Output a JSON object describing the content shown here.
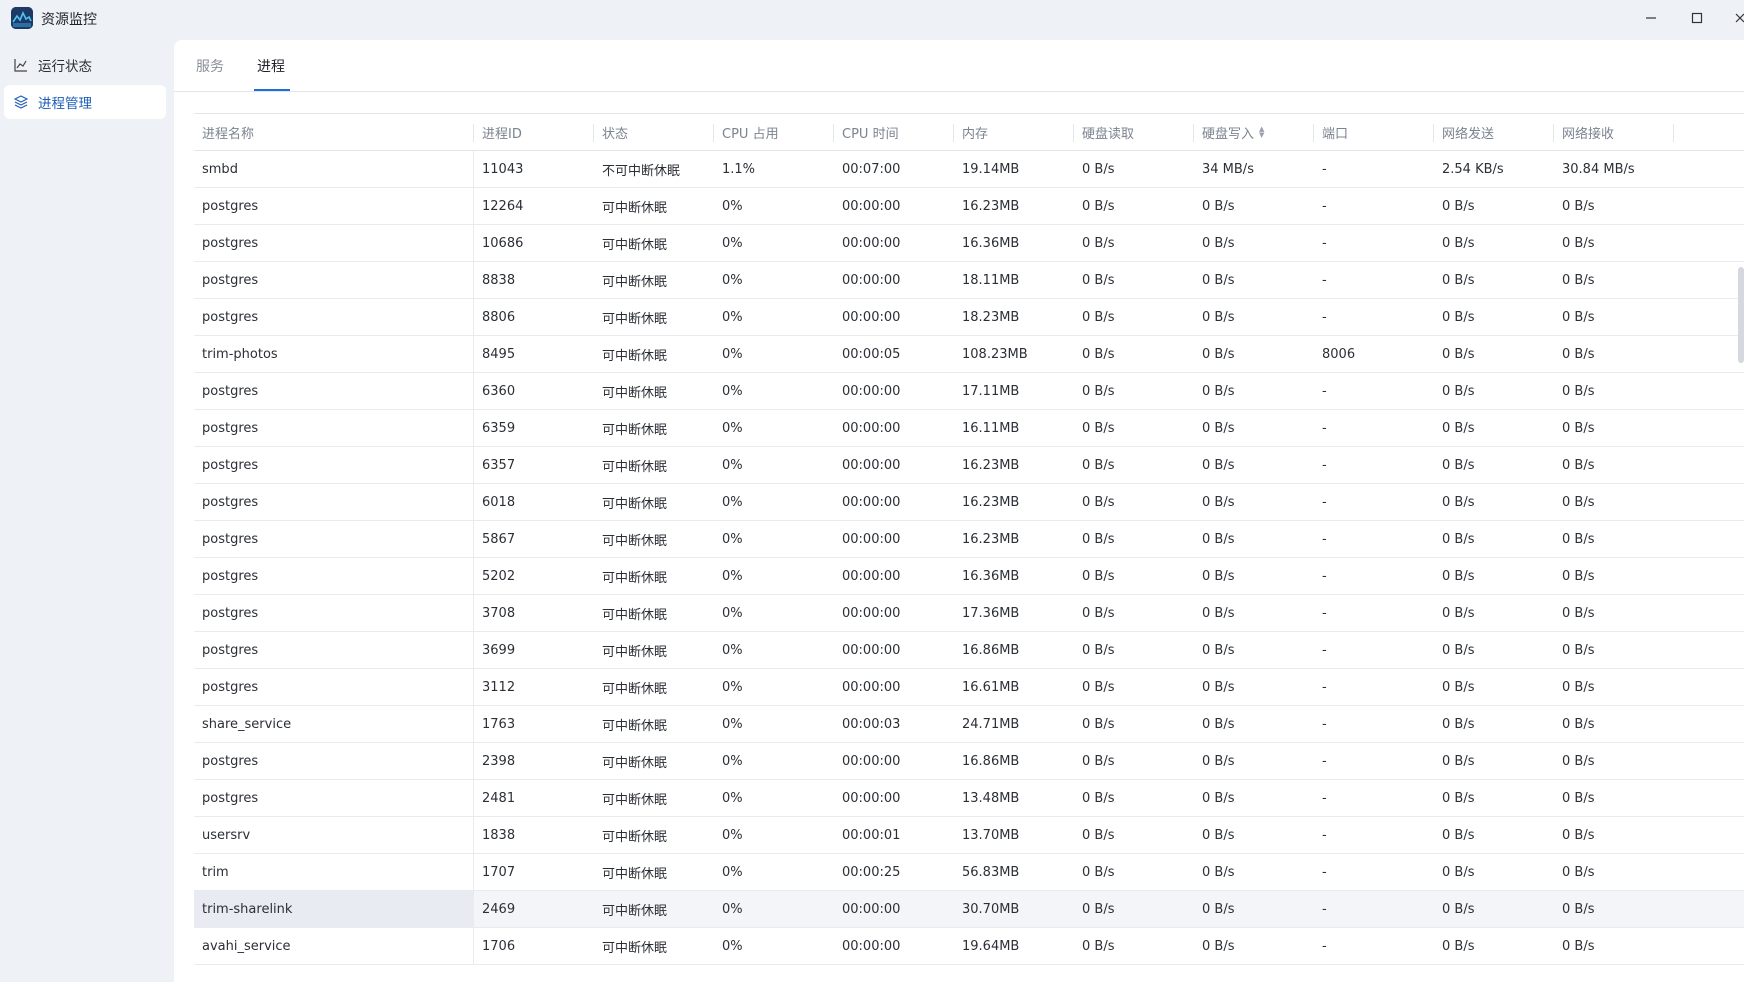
{
  "window": {
    "title": "资源监控",
    "controls": [
      "minimize-icon",
      "maximize-icon",
      "close-icon"
    ]
  },
  "sidebar": {
    "items": [
      {
        "label": "运行状态",
        "icon": "chart-line-icon",
        "active": false
      },
      {
        "label": "进程管理",
        "icon": "layers-icon",
        "active": true
      }
    ]
  },
  "tabs": [
    {
      "label": "服务",
      "active": false
    },
    {
      "label": "进程",
      "active": true
    }
  ],
  "table": {
    "sorted_column": "硬盘写入",
    "columns": [
      "进程名称",
      "进程ID",
      "状态",
      "CPU 占用",
      "CPU 时间",
      "内存",
      "硬盘读取",
      "硬盘写入",
      "端口",
      "网络发送",
      "网络接收"
    ],
    "rows": [
      [
        "smbd",
        "11043",
        "不可中断休眠",
        "1.1%",
        "00:07:00",
        "19.14MB",
        "0 B/s",
        "34 MB/s",
        "-",
        "2.54 KB/s",
        "30.84 MB/s"
      ],
      [
        "postgres",
        "12264",
        "可中断休眠",
        "0%",
        "00:00:00",
        "16.23MB",
        "0 B/s",
        "0 B/s",
        "-",
        "0 B/s",
        "0 B/s"
      ],
      [
        "postgres",
        "10686",
        "可中断休眠",
        "0%",
        "00:00:00",
        "16.36MB",
        "0 B/s",
        "0 B/s",
        "-",
        "0 B/s",
        "0 B/s"
      ],
      [
        "postgres",
        "8838",
        "可中断休眠",
        "0%",
        "00:00:00",
        "18.11MB",
        "0 B/s",
        "0 B/s",
        "-",
        "0 B/s",
        "0 B/s"
      ],
      [
        "postgres",
        "8806",
        "可中断休眠",
        "0%",
        "00:00:00",
        "18.23MB",
        "0 B/s",
        "0 B/s",
        "-",
        "0 B/s",
        "0 B/s"
      ],
      [
        "trim-photos",
        "8495",
        "可中断休眠",
        "0%",
        "00:00:05",
        "108.23MB",
        "0 B/s",
        "0 B/s",
        "8006",
        "0 B/s",
        "0 B/s"
      ],
      [
        "postgres",
        "6360",
        "可中断休眠",
        "0%",
        "00:00:00",
        "17.11MB",
        "0 B/s",
        "0 B/s",
        "-",
        "0 B/s",
        "0 B/s"
      ],
      [
        "postgres",
        "6359",
        "可中断休眠",
        "0%",
        "00:00:00",
        "16.11MB",
        "0 B/s",
        "0 B/s",
        "-",
        "0 B/s",
        "0 B/s"
      ],
      [
        "postgres",
        "6357",
        "可中断休眠",
        "0%",
        "00:00:00",
        "16.23MB",
        "0 B/s",
        "0 B/s",
        "-",
        "0 B/s",
        "0 B/s"
      ],
      [
        "postgres",
        "6018",
        "可中断休眠",
        "0%",
        "00:00:00",
        "16.23MB",
        "0 B/s",
        "0 B/s",
        "-",
        "0 B/s",
        "0 B/s"
      ],
      [
        "postgres",
        "5867",
        "可中断休眠",
        "0%",
        "00:00:00",
        "16.23MB",
        "0 B/s",
        "0 B/s",
        "-",
        "0 B/s",
        "0 B/s"
      ],
      [
        "postgres",
        "5202",
        "可中断休眠",
        "0%",
        "00:00:00",
        "16.36MB",
        "0 B/s",
        "0 B/s",
        "-",
        "0 B/s",
        "0 B/s"
      ],
      [
        "postgres",
        "3708",
        "可中断休眠",
        "0%",
        "00:00:00",
        "17.36MB",
        "0 B/s",
        "0 B/s",
        "-",
        "0 B/s",
        "0 B/s"
      ],
      [
        "postgres",
        "3699",
        "可中断休眠",
        "0%",
        "00:00:00",
        "16.86MB",
        "0 B/s",
        "0 B/s",
        "-",
        "0 B/s",
        "0 B/s"
      ],
      [
        "postgres",
        "3112",
        "可中断休眠",
        "0%",
        "00:00:00",
        "16.61MB",
        "0 B/s",
        "0 B/s",
        "-",
        "0 B/s",
        "0 B/s"
      ],
      [
        "share_service",
        "1763",
        "可中断休眠",
        "0%",
        "00:00:03",
        "24.71MB",
        "0 B/s",
        "0 B/s",
        "-",
        "0 B/s",
        "0 B/s"
      ],
      [
        "postgres",
        "2398",
        "可中断休眠",
        "0%",
        "00:00:00",
        "16.86MB",
        "0 B/s",
        "0 B/s",
        "-",
        "0 B/s",
        "0 B/s"
      ],
      [
        "postgres",
        "2481",
        "可中断休眠",
        "0%",
        "00:00:00",
        "13.48MB",
        "0 B/s",
        "0 B/s",
        "-",
        "0 B/s",
        "0 B/s"
      ],
      [
        "usersrv",
        "1838",
        "可中断休眠",
        "0%",
        "00:00:01",
        "13.70MB",
        "0 B/s",
        "0 B/s",
        "-",
        "0 B/s",
        "0 B/s"
      ],
      [
        "trim",
        "1707",
        "可中断休眠",
        "0%",
        "00:00:25",
        "56.83MB",
        "0 B/s",
        "0 B/s",
        "-",
        "0 B/s",
        "0 B/s"
      ],
      [
        "trim-sharelink",
        "2469",
        "可中断休眠",
        "0%",
        "00:00:00",
        "30.70MB",
        "0 B/s",
        "0 B/s",
        "-",
        "0 B/s",
        "0 B/s"
      ],
      [
        "avahi_service",
        "1706",
        "可中断休眠",
        "0%",
        "00:00:00",
        "19.64MB",
        "0 B/s",
        "0 B/s",
        "-",
        "0 B/s",
        "0 B/s"
      ]
    ],
    "highlighted_row": 20
  }
}
